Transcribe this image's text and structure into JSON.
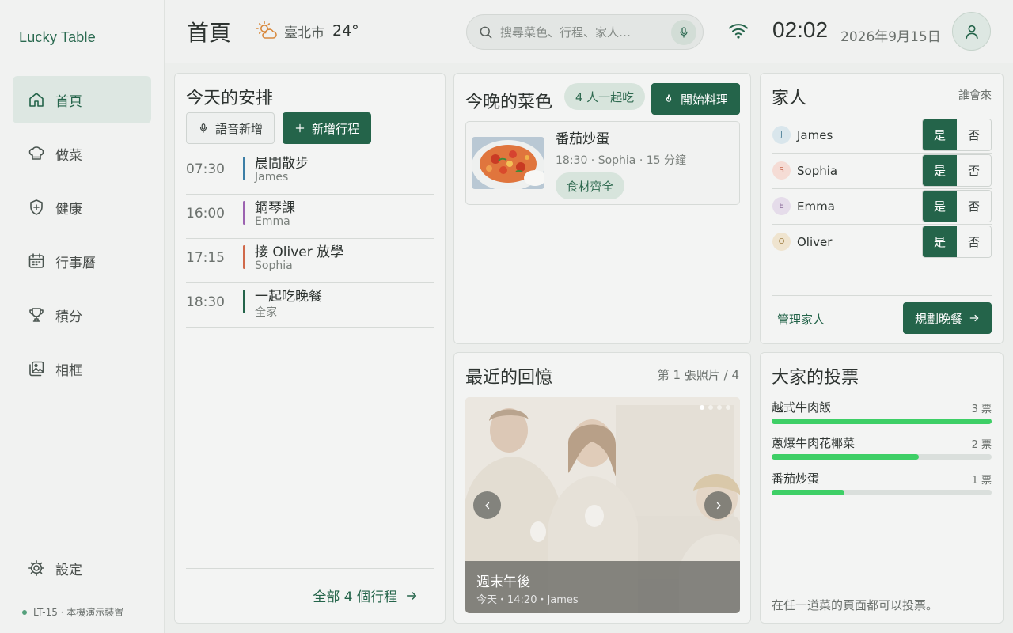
{
  "sidebar": {
    "brand": "Lucky Table",
    "items": [
      {
        "label": "首頁",
        "icon": "home-icon",
        "active": true
      },
      {
        "label": "做菜",
        "icon": "chef-hat-icon",
        "active": false
      },
      {
        "label": "健康",
        "icon": "shield-plus-icon",
        "active": false
      },
      {
        "label": "行事曆",
        "icon": "calendar-icon",
        "active": false
      },
      {
        "label": "積分",
        "icon": "trophy-icon",
        "active": false
      },
      {
        "label": "相框",
        "icon": "photo-frame-icon",
        "active": false
      }
    ],
    "settings_label": "設定",
    "device_label": "LT-15 · 本機演示裝置"
  },
  "header": {
    "title": "首頁",
    "city": "臺北市",
    "temperature": "24°",
    "search_placeholder": "搜尋菜色、行程、家人…",
    "time": "02:02",
    "date": "2026年9月15日"
  },
  "schedule": {
    "title": "今天的安排",
    "voice_add_label": "語音新增",
    "add_label": "新增行程",
    "items": [
      {
        "time": "07:30",
        "title": "晨間散步",
        "person": "James",
        "color": "#3b7ea6"
      },
      {
        "time": "16:00",
        "title": "鋼琴課",
        "person": "Emma",
        "color": "#9b62b0"
      },
      {
        "time": "17:15",
        "title": "接 Oliver 放學",
        "person": "Sophia",
        "color": "#d0694a"
      },
      {
        "time": "18:30",
        "title": "一起吃晚餐",
        "person": "全家",
        "color": "#24644a"
      }
    ],
    "all_link": "全部 4 個行程"
  },
  "tonight": {
    "title": "今晚的菜色",
    "diners": "4 人一起吃",
    "start_label": "開始料理",
    "dish_name": "番茄炒蛋",
    "dish_meta": "18:30 · Sophia · 15 分鐘",
    "dish_badge": "食材齊全"
  },
  "family": {
    "title": "家人",
    "subtitle": "誰會來",
    "yes_label": "是",
    "no_label": "否",
    "members": [
      {
        "name": "James",
        "initial": "J",
        "bg": "#d9e6ec",
        "fg": "#5a8aa0"
      },
      {
        "name": "Sophia",
        "initial": "S",
        "bg": "#f5dcd5",
        "fg": "#c86a52"
      },
      {
        "name": "Emma",
        "initial": "E",
        "bg": "#e5dcea",
        "fg": "#8a6a9a"
      },
      {
        "name": "Oliver",
        "initial": "O",
        "bg": "#efe4cf",
        "fg": "#a08046"
      }
    ],
    "manage_label": "管理家人",
    "plan_label": "規劃晚餐"
  },
  "memories": {
    "title": "最近的回憶",
    "photo_count": "第 1 張照片 / 4",
    "caption_title": "週末午後",
    "caption_meta": "今天・14:20・James"
  },
  "votes": {
    "title": "大家的投票",
    "items": [
      {
        "name": "越式牛肉飯",
        "count": "3 票",
        "fraction": 1.0
      },
      {
        "name": "蔥爆牛肉花椰菜",
        "count": "2 票",
        "fraction": 0.67
      },
      {
        "name": "番茄炒蛋",
        "count": "1 票",
        "fraction": 0.33
      }
    ],
    "note": "在任一道菜的頁面都可以投票。"
  },
  "colors": {
    "accent": "#24644a",
    "vote_fill": "#3ecf66"
  }
}
